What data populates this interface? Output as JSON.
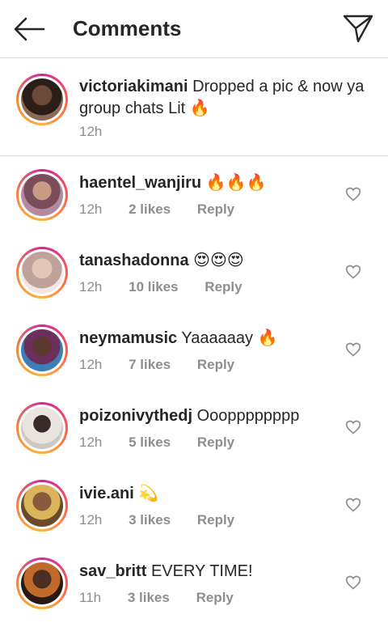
{
  "header": {
    "title": "Comments",
    "back_icon": "arrow-left-icon",
    "send_icon": "paper-plane-icon"
  },
  "caption": {
    "username": "victoriakimani",
    "text": "Dropped a pic & now ya group chats Lit",
    "emoji": "🔥",
    "time": "12h"
  },
  "comments": [
    {
      "username": "haentel_wanjiru",
      "text": "",
      "emoji": "🔥🔥🔥",
      "time": "12h",
      "likes": "2 likes",
      "reply": "Reply"
    },
    {
      "username": "tanashadonna",
      "text": "",
      "emoji": "😍😍😍",
      "time": "12h",
      "likes": "10 likes",
      "reply": "Reply"
    },
    {
      "username": "neymamusic",
      "text": "Yaaaaaay",
      "emoji": "🔥",
      "time": "12h",
      "likes": "7 likes",
      "reply": "Reply"
    },
    {
      "username": "poizonivythedj",
      "text": "Ooopppppppp",
      "emoji": "",
      "time": "12h",
      "likes": "5 likes",
      "reply": "Reply"
    },
    {
      "username": "ivie.ani",
      "text": "",
      "emoji": "💫",
      "time": "12h",
      "likes": "3 likes",
      "reply": "Reply"
    },
    {
      "username": "sav_britt",
      "text": "EVERY TIME!",
      "emoji": "",
      "time": "11h",
      "likes": "3 likes",
      "reply": "Reply"
    }
  ],
  "colors": {
    "text": "#262626",
    "secondary": "#8e8e8e",
    "divider": "#dbdbdb",
    "story_ring": [
      "#d6249f",
      "#fd5949",
      "#fdb23f"
    ]
  }
}
